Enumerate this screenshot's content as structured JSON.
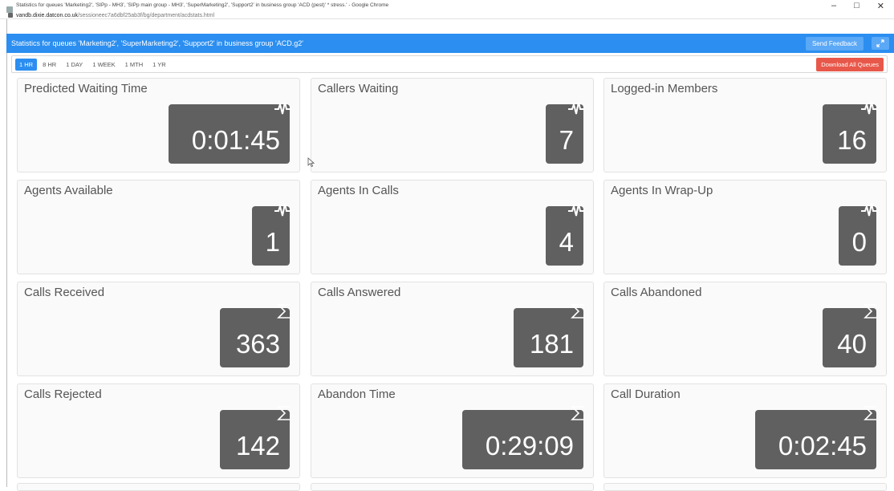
{
  "browser": {
    "window_title": "Statistics for queues 'Marketing2', 'SIPp - MH3', 'SIPp main group - MH3', 'SuperMarketing2', 'Support2' in business group 'ACD (pest)' * stress.' - Google Chrome",
    "url_host": "vandb.dixie.datcon.co.uk",
    "url_path": "/sessioneec7a6dbf25ab3f/bg/department/acdstats.html",
    "minimize": "–",
    "maximize": "□",
    "close": "✕"
  },
  "appbar": {
    "heading": "Statistics for queues 'Marketing2', 'SuperMarketing2', 'Support2' in business group 'ACD.g2'",
    "feedback_label": "Send Feedback",
    "expand_icon": "expand-icon"
  },
  "range": {
    "tabs": [
      "1 HR",
      "8 HR",
      "1 DAY",
      "1 WEEK",
      "1 MTH",
      "1 YR"
    ],
    "active": "1 HR",
    "download_label": "Download All Queues"
  },
  "colors": {
    "appbar": "#2b8ef0",
    "download": "#e8584a",
    "value_box": "#606060"
  },
  "cards": [
    {
      "label": "Predicted Waiting Time",
      "value": "0:01:45",
      "icon": "pulse-icon"
    },
    {
      "label": "Callers Waiting",
      "value": "7",
      "icon": "pulse-icon"
    },
    {
      "label": "Logged-in Members",
      "value": "16",
      "icon": "pulse-icon"
    },
    {
      "label": "Agents Available",
      "value": "1",
      "icon": "pulse-icon"
    },
    {
      "label": "Agents In Calls",
      "value": "4",
      "icon": "pulse-icon"
    },
    {
      "label": "Agents In Wrap-Up",
      "value": "0",
      "icon": "pulse-icon"
    },
    {
      "label": "Calls Received",
      "value": "363",
      "icon": "sigma-icon"
    },
    {
      "label": "Calls Answered",
      "value": "181",
      "icon": "sigma-icon"
    },
    {
      "label": "Calls Abandoned",
      "value": "40",
      "icon": "sigma-icon"
    },
    {
      "label": "Calls Rejected",
      "value": "142",
      "icon": "sigma-icon"
    },
    {
      "label": "Abandon Time",
      "value": "0:29:09",
      "icon": "sigma-icon"
    },
    {
      "label": "Call Duration",
      "value": "0:02:45",
      "icon": "sigma-icon"
    }
  ]
}
